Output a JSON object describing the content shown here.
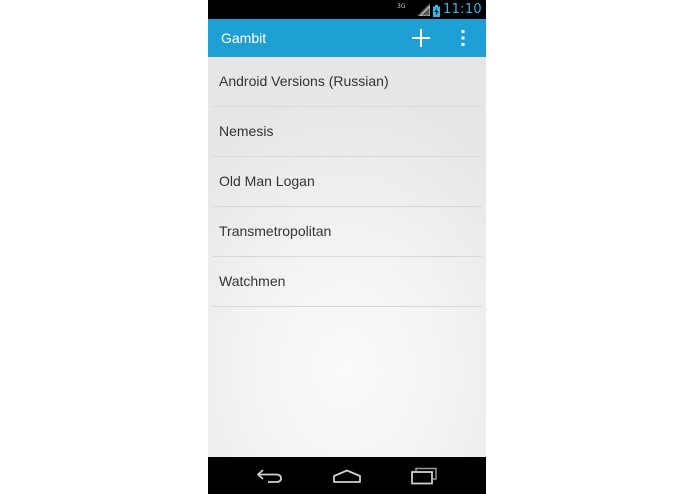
{
  "status_bar": {
    "network": "3G",
    "time": "11:10"
  },
  "action_bar": {
    "title": "Gambit",
    "actions": [
      "add-icon",
      "overflow-menu-icon"
    ]
  },
  "list": {
    "items": [
      {
        "label": "Android Versions (Russian)"
      },
      {
        "label": "Nemesis"
      },
      {
        "label": "Old Man Logan"
      },
      {
        "label": "Transmetropolitan"
      },
      {
        "label": "Watchmen"
      }
    ]
  },
  "nav_bar": {
    "buttons": [
      "back-icon",
      "home-icon",
      "recent-apps-icon"
    ]
  },
  "colors": {
    "action_bar": "#1fa0d5",
    "clock": "#33b5e5",
    "status_bar": "#000000",
    "nav_bar": "#000000"
  }
}
